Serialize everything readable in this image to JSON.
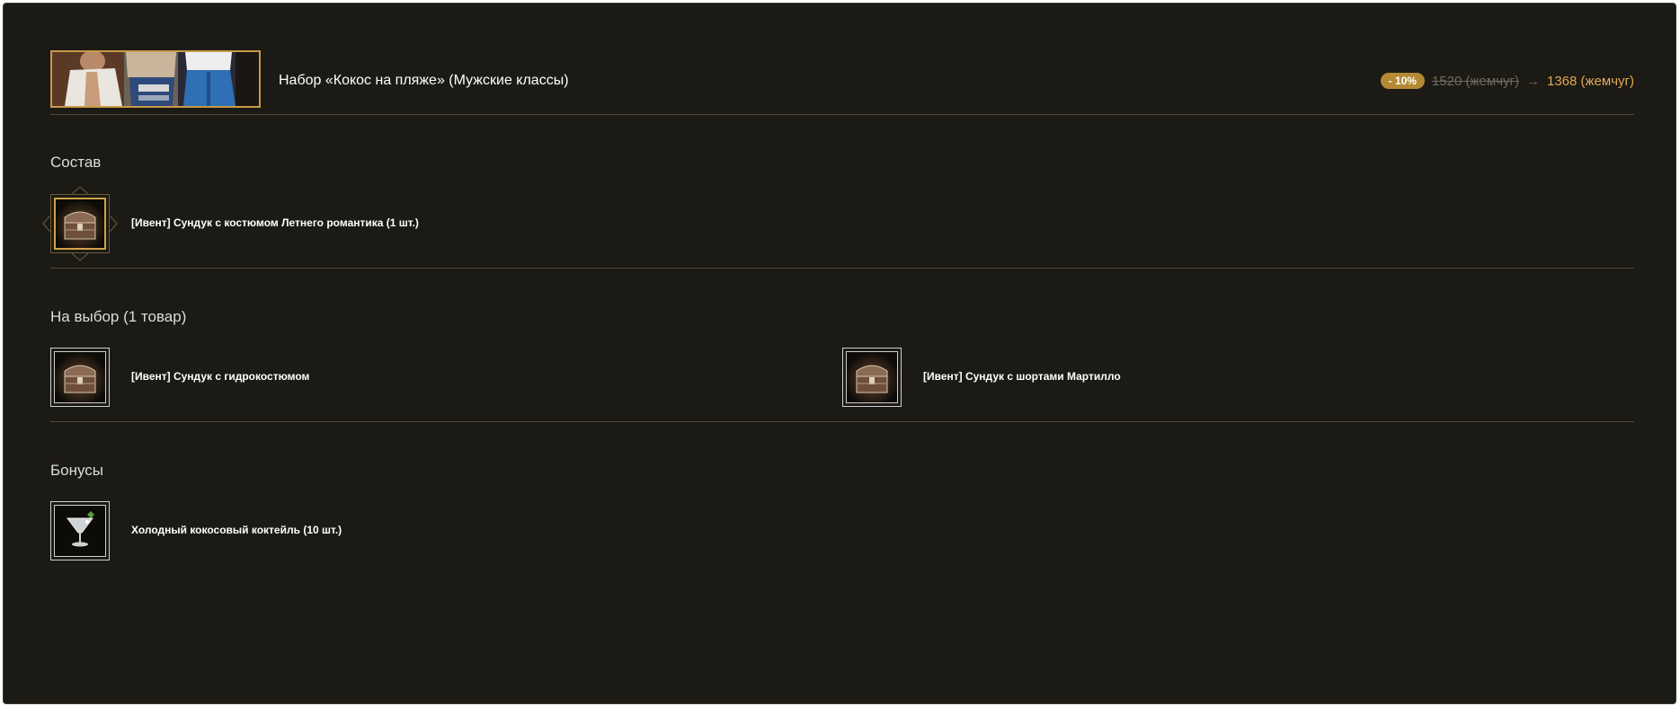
{
  "pack": {
    "title": "Набор «Кокос на пляже» (Мужские классы)",
    "discount": "- 10%",
    "old_price": "1520 (жемчуг)",
    "arrow": "→",
    "new_price": "1368 (жемчуг)"
  },
  "composition": {
    "title": "Состав",
    "items": [
      {
        "label": "[Ивент] Сундук с костюмом Летнего романтика (1 шт.)",
        "icon": "chest-icon"
      }
    ]
  },
  "choice": {
    "title": "На выбор (1 товар)",
    "items": [
      {
        "label": "[Ивент] Сундук с гидрокостюмом",
        "icon": "chest-icon"
      },
      {
        "label": "[Ивент] Сундук с шортами Мартилло",
        "icon": "chest-icon"
      }
    ]
  },
  "bonuses": {
    "title": "Бонусы",
    "items": [
      {
        "label": "Холодный кокосовый коктейль (10 шт.)",
        "icon": "cocktail-icon"
      }
    ]
  },
  "colors": {
    "panel_bg": "#1c1a14",
    "accent_gold": "#d2a04a",
    "new_price": "#e0a95a",
    "discount_badge": "#b58a35"
  }
}
